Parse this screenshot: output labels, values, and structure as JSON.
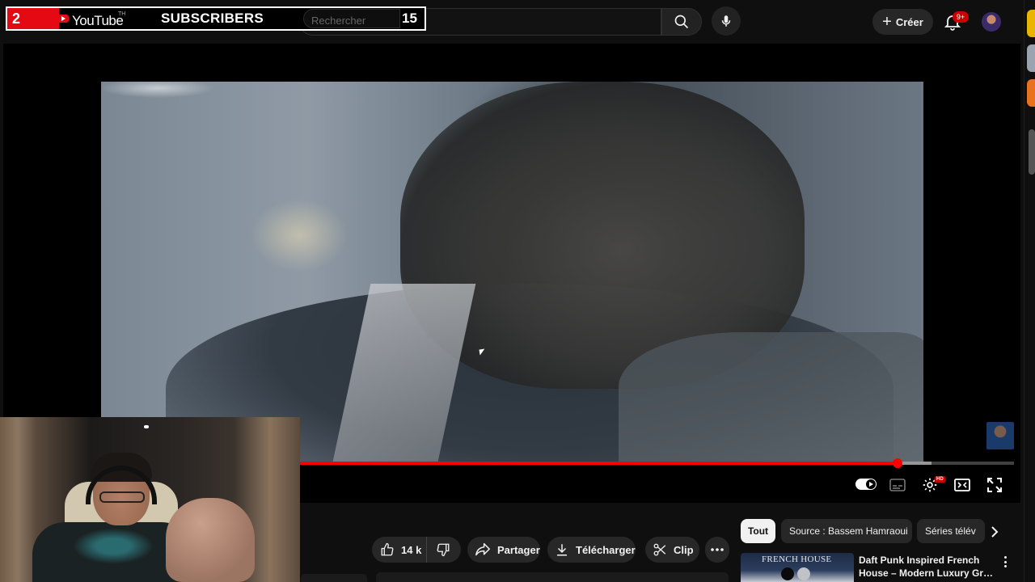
{
  "overlay": {
    "count_left": "2",
    "logo_text": "YouTube",
    "logo_region": "TH",
    "label": "SUBSCRIBERS",
    "count_right": "15"
  },
  "header": {
    "search_placeholder": "Rechercher",
    "create_label": "Créer",
    "notification_count": "9+"
  },
  "player": {
    "progress_fraction": 0.885,
    "buffer_fraction": 0.918,
    "autoplay": "on",
    "hd_badge": "HD"
  },
  "actions": {
    "like_count": "14 k",
    "share_label": "Partager",
    "download_label": "Télécharger",
    "clip_label": "Clip"
  },
  "chips": {
    "items": [
      {
        "label": "Tout",
        "active": true
      },
      {
        "label": "Source : Bassem Hamraoui",
        "active": false
      },
      {
        "label": "Séries télév",
        "active": false
      }
    ]
  },
  "recommendation": {
    "thumb_text": "FRENCH HOUSE",
    "title_line1": "Daft Punk Inspired French",
    "title_line2": "House – Modern Luxury Groov..."
  },
  "colors": {
    "accent": "#ff0000",
    "background": "#0f0f0f",
    "pill": "#272727",
    "overlay_red": "#e50914"
  },
  "icons": [
    "search-icon",
    "mic-icon",
    "plus-icon",
    "bell-icon",
    "like-icon",
    "dislike-icon",
    "share-icon",
    "download-icon",
    "scissors-icon",
    "more-icon",
    "subtitles-icon",
    "settings-icon",
    "theater-icon",
    "fullscreen-icon",
    "chevron-right-icon",
    "kebab-icon"
  ]
}
